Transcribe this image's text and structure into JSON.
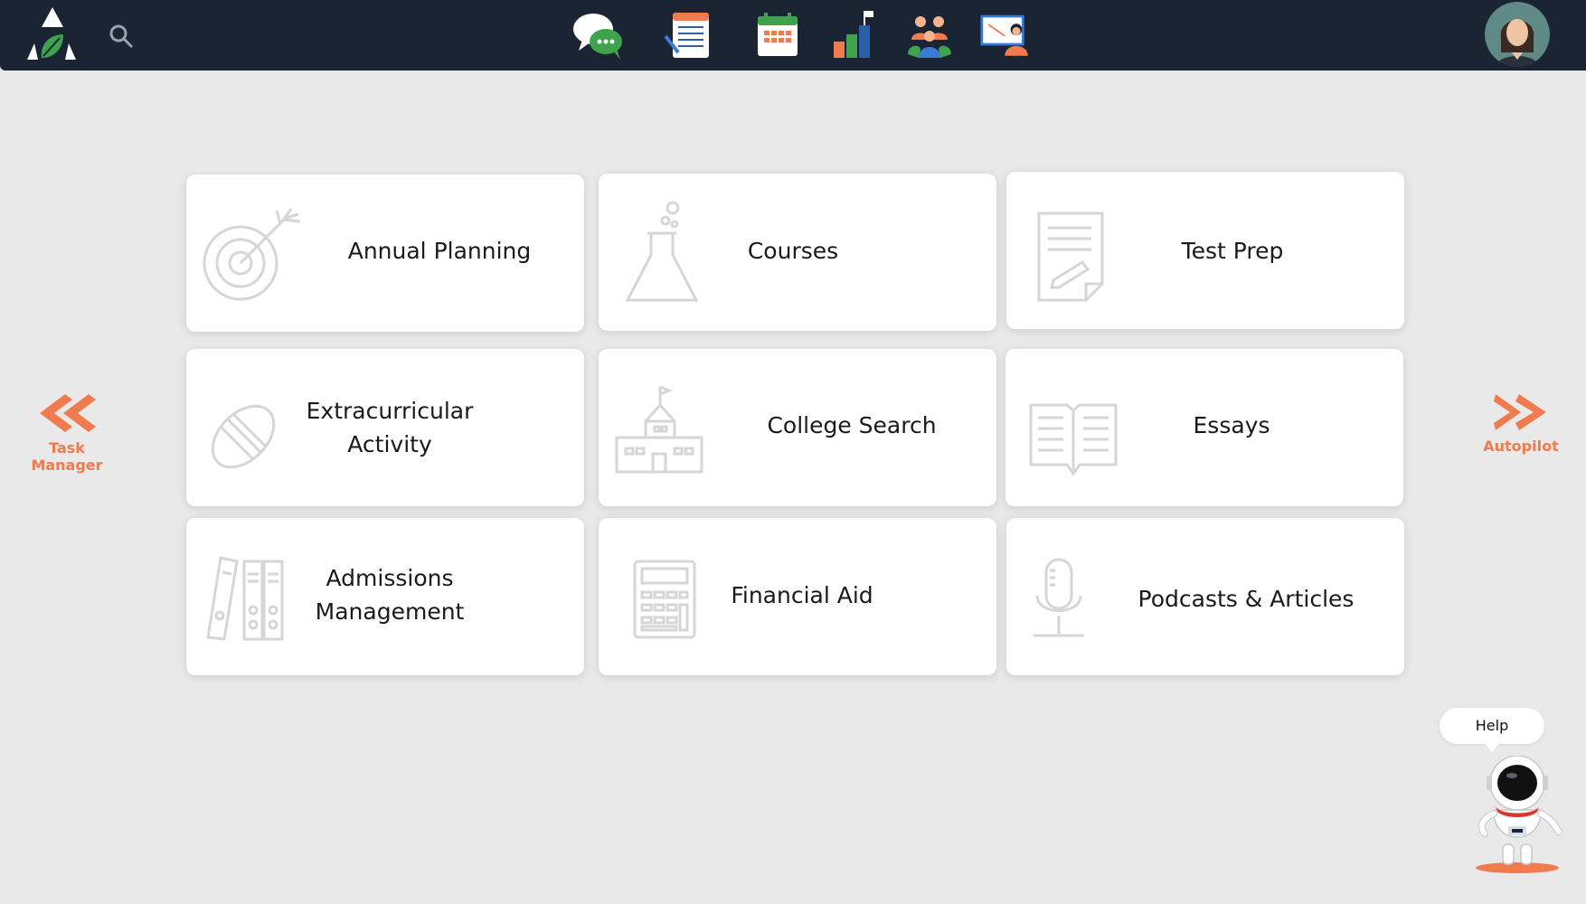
{
  "header": {
    "logo_icon": "summit-leaf-logo",
    "search_icon": "search-icon",
    "nav_icons": [
      "chat-bubbles-icon",
      "notes-icon",
      "calendar-icon",
      "progress-chart-icon",
      "group-icon",
      "presentation-icon"
    ],
    "avatar_icon": "user-avatar"
  },
  "cards": [
    {
      "label": "Annual Planning",
      "icon": "target-icon"
    },
    {
      "label": "Courses",
      "icon": "flask-icon"
    },
    {
      "label": "Test Prep",
      "icon": "test-paper-icon"
    },
    {
      "label": "Extracurricular\nActivity",
      "icon": "football-icon"
    },
    {
      "label": "College Search",
      "icon": "college-building-icon"
    },
    {
      "label": "Essays",
      "icon": "open-book-icon"
    },
    {
      "label": "Admissions\nManagement",
      "icon": "binders-icon"
    },
    {
      "label": "Financial Aid",
      "icon": "calculator-icon"
    },
    {
      "label": "Podcasts & Articles",
      "icon": "microphone-icon"
    }
  ],
  "left_nav": {
    "label": "Task Manager",
    "icon": "double-chevron-left-icon"
  },
  "right_nav": {
    "label": "Autopilot",
    "icon": "double-chevron-right-icon"
  },
  "help": {
    "label": "Help",
    "icon": "astronaut-icon"
  },
  "colors": {
    "topbar": "#1a2433",
    "accent": "#f07b4f",
    "background": "#e9e9e9"
  }
}
